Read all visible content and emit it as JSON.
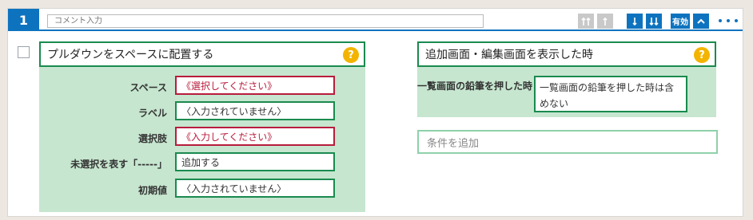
{
  "row_number": "1",
  "comment_placeholder": "コメント入力",
  "toolbar": {
    "enable_label": "有効"
  },
  "left_panel": {
    "title": "プルダウンをスペースに配置する",
    "help": "?",
    "rows": [
      {
        "label": "スペース",
        "value": "《選択してください》",
        "required": true
      },
      {
        "label": "ラベル",
        "value": "〈入力されていません〉",
        "required": false
      },
      {
        "label": "選択肢",
        "value": "《入力してください》",
        "required": true
      },
      {
        "label": "未選択を表す「-----」",
        "value": "追加する",
        "required": false
      },
      {
        "label": "初期値",
        "value": "〈入力されていません〉",
        "required": false
      }
    ]
  },
  "right_panel": {
    "title": "追加画面・編集画面を表示した時",
    "help": "?",
    "condition_label": "一覧画面の鉛筆を押した時",
    "condition_value": "一覧画面の鉛筆を押した時は含めない"
  },
  "add_condition_label": "条件を追加",
  "colors": {
    "accent": "#0e73bf",
    "green_border": "#1a8a4e",
    "green_bg": "#c6e6cf",
    "required_border": "#b81c3c",
    "help_yellow": "#f3b400"
  }
}
